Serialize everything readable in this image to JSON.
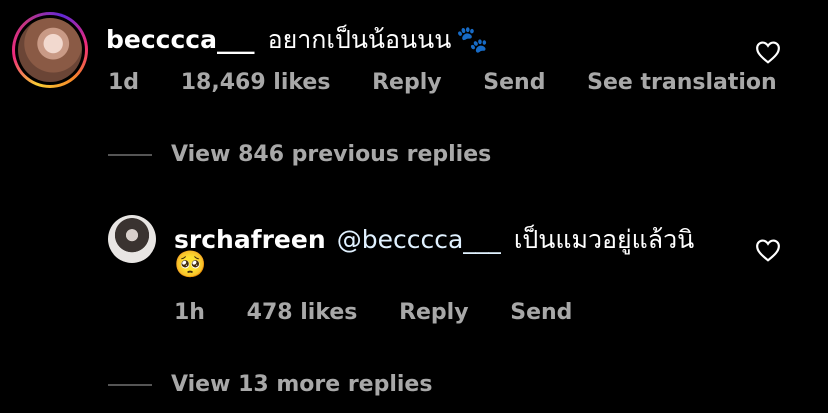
{
  "comment": {
    "username": "becccca___",
    "text": "อยากเป็นน้อนนน",
    "emoji": "🐾",
    "meta": {
      "time": "1d",
      "likes": "18,469 likes",
      "reply": "Reply",
      "send": "Send",
      "translate": "See translation"
    }
  },
  "view_previous": "View 846 previous replies",
  "reply": {
    "username": "srchafreen",
    "mention": "@becccca___",
    "text": "เป็นแมวอยู่แล้วนิ",
    "emoji": "🥺",
    "meta": {
      "time": "1h",
      "likes": "478 likes",
      "reply": "Reply",
      "send": "Send"
    }
  },
  "view_more": "View 13 more replies"
}
